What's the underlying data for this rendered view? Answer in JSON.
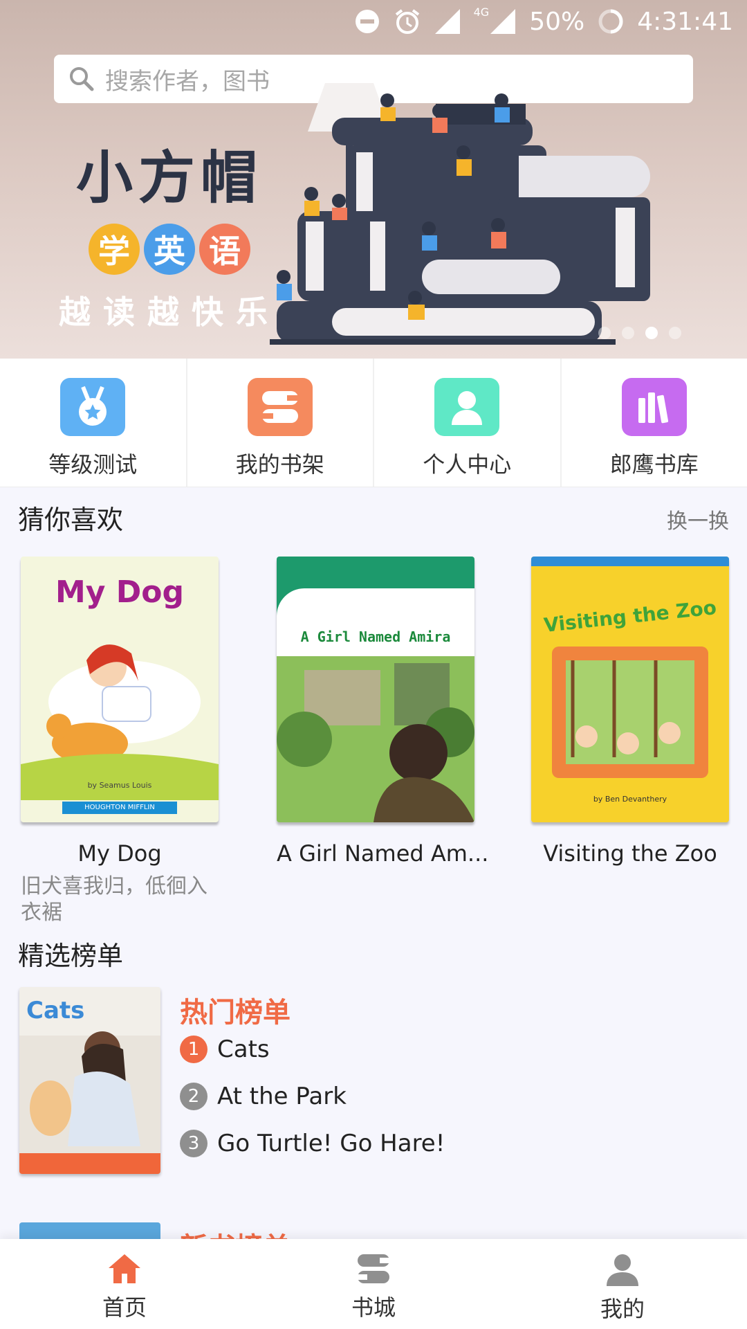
{
  "status_bar": {
    "battery": "50%",
    "time": "4:31:41",
    "network": "4G"
  },
  "search": {
    "placeholder": "搜索作者，图书",
    "icon": "search-icon"
  },
  "banner": {
    "title": "小方帽",
    "circles": [
      "学",
      "英",
      "语"
    ],
    "slogan": "越读越快乐",
    "colors": {
      "circle1": "#f5b42b",
      "circle2": "#4b9de9",
      "circle3": "#f27a5a"
    }
  },
  "quick_menu": [
    {
      "label": "等级测试",
      "icon": "medal-icon",
      "color": "#5fb1f4"
    },
    {
      "label": "我的书架",
      "icon": "bookshelf-icon",
      "color": "#f58a5e"
    },
    {
      "label": "个人中心",
      "icon": "person-icon",
      "color": "#5fe8c6"
    },
    {
      "label": "郎鹰书库",
      "icon": "library-icon",
      "color": "#c66bf0"
    }
  ],
  "recommend": {
    "title": "猜你喜欢",
    "refresh": "换一换",
    "books": [
      {
        "cover_title": "My Dog",
        "credit": "by Seamus Louis",
        "publisher": "HOUGHTON MIFFLIN",
        "title": "My Dog",
        "desc": "旧犬喜我归，低徊入衣裾"
      },
      {
        "cover_title": "A Girl Named Amira",
        "title": "A Girl Named Am..."
      },
      {
        "cover_title": "Visiting the Zoo",
        "credit": "by Ben Devanthery",
        "title": "Visiting the Zoo"
      }
    ]
  },
  "ranking": {
    "title": "精选榜单",
    "hot": {
      "head": "热门榜单",
      "cover_title": "Cats",
      "items": [
        {
          "num": "1",
          "title": "Cats"
        },
        {
          "num": "2",
          "title": "At the Park"
        },
        {
          "num": "3",
          "title": "Go Turtle! Go Hare!"
        }
      ]
    },
    "next_head": "新书榜单"
  },
  "bottom_nav": [
    {
      "label": "首页",
      "icon": "home-icon",
      "active": true
    },
    {
      "label": "书城",
      "icon": "bookstore-icon",
      "active": false
    },
    {
      "label": "我的",
      "icon": "profile-icon",
      "active": false
    }
  ],
  "colors": {
    "accent": "#f06a45",
    "inactive": "#8f8f8f"
  }
}
